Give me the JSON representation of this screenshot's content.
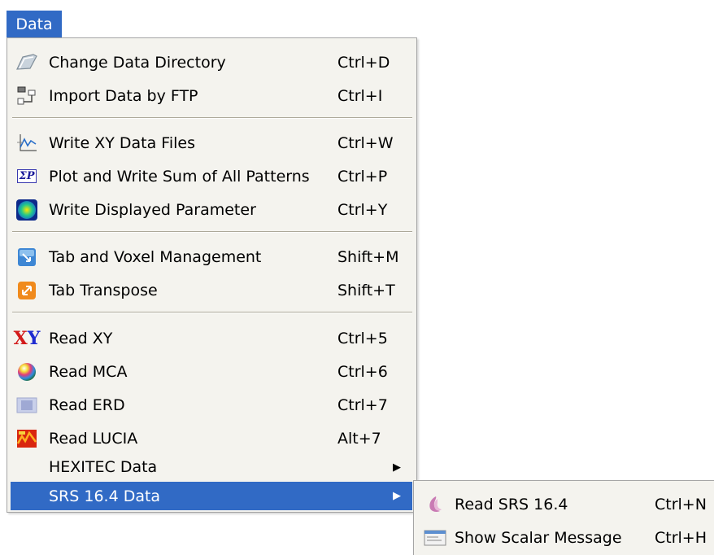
{
  "menubar": {
    "data_label": "Data"
  },
  "menu": {
    "change_dir": {
      "label": "Change Data Directory",
      "shortcut": "Ctrl+D",
      "icon": "folder-icon"
    },
    "import_ftp": {
      "label": "Import Data by FTP",
      "shortcut": "Ctrl+I",
      "icon": "network-icon"
    },
    "write_xy": {
      "label": "Write XY Data Files",
      "shortcut": "Ctrl+W",
      "icon": "xy-graph-icon"
    },
    "plot_sum": {
      "label": "Plot and Write Sum of All Patterns",
      "shortcut": "Ctrl+P",
      "icon": "sigma-p-icon",
      "icon_text": "ΣP"
    },
    "write_param": {
      "label": "Write Displayed Parameter",
      "shortcut": "Ctrl+Y",
      "icon": "parameter-map-icon"
    },
    "tab_voxel": {
      "label": "Tab and Voxel Management",
      "shortcut": "Shift+M",
      "icon": "voxel-icon"
    },
    "tab_transpose": {
      "label": "Tab Transpose",
      "shortcut": "Shift+T",
      "icon": "transpose-icon"
    },
    "read_xy": {
      "label": "Read XY",
      "shortcut": "Ctrl+5",
      "icon": "xy-text-icon",
      "icon_x": "X",
      "icon_y": "Y"
    },
    "read_mca": {
      "label": "Read MCA",
      "shortcut": "Ctrl+6",
      "icon": "color-sphere-icon"
    },
    "read_erd": {
      "label": "Read ERD",
      "shortcut": "Ctrl+7",
      "icon": "erd-icon"
    },
    "read_lucia": {
      "label": "Read LUCIA",
      "shortcut": "Alt+7",
      "icon": "lucia-icon"
    },
    "hexitec": {
      "label": "HEXITEC Data",
      "arrow": "▶"
    },
    "srs": {
      "label": "SRS 16.4 Data",
      "arrow": "▶"
    }
  },
  "submenu": {
    "read_srs": {
      "label": "Read SRS 16.4",
      "shortcut": "Ctrl+N",
      "icon": "srs-icon"
    },
    "show_scalar": {
      "label": "Show Scalar Message",
      "shortcut": "Ctrl+H",
      "icon": "message-window-icon"
    }
  },
  "colors": {
    "selection": "#316ac5",
    "menu_bg": "#f4f3ee"
  }
}
